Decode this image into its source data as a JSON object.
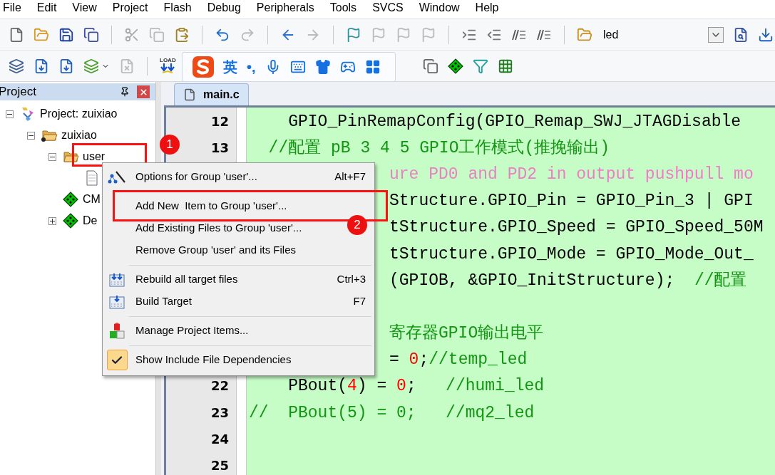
{
  "menu_bar": [
    "File",
    "Edit",
    "View",
    "Project",
    "Flash",
    "Debug",
    "Peripherals",
    "Tools",
    "SVCS",
    "Window",
    "Help"
  ],
  "toolbar": {
    "target": "led",
    "load_label": "LOAD"
  },
  "ime_bar": {
    "items": [
      {
        "kind": "logo"
      },
      {
        "kind": "text",
        "text": "英"
      },
      {
        "kind": "text",
        "text": "•,"
      },
      {
        "kind": "mic"
      },
      {
        "kind": "keyboard"
      },
      {
        "kind": "skin"
      },
      {
        "kind": "game"
      },
      {
        "kind": "apps"
      }
    ]
  },
  "project_panel": {
    "title": "Project",
    "tree": [
      {
        "label": "Project: zuixiao",
        "kind": "project",
        "expanded": true,
        "children": [
          {
            "label": "zuixiao",
            "kind": "target",
            "expanded": true,
            "children": [
              {
                "label": "user",
                "kind": "group",
                "expanded": true,
                "annotation": "1",
                "children": [
                  {
                    "kind": "file"
                  }
                ]
              },
              {
                "label": "CM",
                "kind": "component"
              },
              {
                "label": "De",
                "kind": "component",
                "expanded": false
              }
            ]
          }
        ]
      }
    ]
  },
  "editor": {
    "tabs": [
      {
        "label": "main.c",
        "selected": true
      }
    ],
    "lines": [
      {
        "kind": "full",
        "number": "12",
        "segments": [
          {
            "kind": "code",
            "text": "    GPIO_PinRemapConfig(GPIO_Remap_SWJ_JTAGDisable"
          }
        ]
      },
      {
        "kind": "full",
        "number": "13",
        "segments": [
          {
            "kind": "comment",
            "text": "  //配置 pB 3 4 5 GPIO工作模式(推挽输出)"
          }
        ]
      },
      {
        "kind": "covered",
        "segments": [
          {
            "kind": "doc",
            "text": "ure PD0 and PD2 in output pushpull mo"
          }
        ]
      },
      {
        "kind": "covered",
        "segments": [
          {
            "kind": "code",
            "text": "Structure.GPIO_Pin = GPIO_Pin_3 | GPI"
          }
        ]
      },
      {
        "kind": "covered",
        "segments": [
          {
            "kind": "code",
            "text": "tStructure.GPIO_Speed = GPIO_Speed_50M"
          }
        ]
      },
      {
        "kind": "covered",
        "segments": [
          {
            "kind": "code",
            "text": "tStructure.GPIO_Mode = GPIO_Mode_Out_"
          }
        ]
      },
      {
        "kind": "covered",
        "segments": [
          {
            "kind": "code",
            "text": "(GPIOB, &GPIO_InitStructure);  "
          },
          {
            "kind": "comment",
            "text": "//配置"
          }
        ]
      },
      {
        "kind": "blank"
      },
      {
        "kind": "covered",
        "segments": [
          {
            "kind": "comment",
            "text": "寄存器GPIO输出电平"
          }
        ]
      },
      {
        "kind": "covered",
        "segments": [
          {
            "kind": "code",
            "text": "= "
          },
          {
            "kind": "number",
            "text": "0"
          },
          {
            "kind": "code",
            "text": ";"
          },
          {
            "kind": "comment",
            "text": "//temp_led"
          }
        ]
      },
      {
        "kind": "full",
        "number": "22",
        "segments": [
          {
            "kind": "code",
            "text": "    PBout("
          },
          {
            "kind": "number",
            "text": "4"
          },
          {
            "kind": "code",
            "text": ") = "
          },
          {
            "kind": "number",
            "text": "0"
          },
          {
            "kind": "code",
            "text": ";   "
          },
          {
            "kind": "comment",
            "text": "//humi_led"
          }
        ]
      },
      {
        "kind": "full",
        "number": "23",
        "segments": [
          {
            "kind": "comment",
            "text": "//  PBout(5) = 0;   //mq2_led"
          }
        ]
      },
      {
        "kind": "full",
        "number": "24"
      },
      {
        "kind": "full",
        "number": "25"
      }
    ]
  },
  "context_menu": {
    "items": [
      {
        "kind": "options",
        "label": "Options for Group 'user'...",
        "shortcut": "Alt+F7"
      },
      {
        "kind": "separator"
      },
      {
        "kind": "plain",
        "label": "Add New  Item to Group 'user'...",
        "annotation": "2"
      },
      {
        "kind": "plain",
        "label": "Add Existing Files to Group 'user'..."
      },
      {
        "kind": "plain",
        "label": "Remove Group 'user' and its Files"
      },
      {
        "kind": "separator"
      },
      {
        "kind": "rebuild",
        "label": "Rebuild all target files",
        "shortcut": "Ctrl+3"
      },
      {
        "kind": "build",
        "label": "Build Target",
        "shortcut": "F7"
      },
      {
        "kind": "separator"
      },
      {
        "kind": "manage",
        "label": "Manage Project Items..."
      },
      {
        "kind": "separator"
      },
      {
        "kind": "toggle",
        "label": "Show Include File Dependencies",
        "checked": true
      }
    ]
  }
}
